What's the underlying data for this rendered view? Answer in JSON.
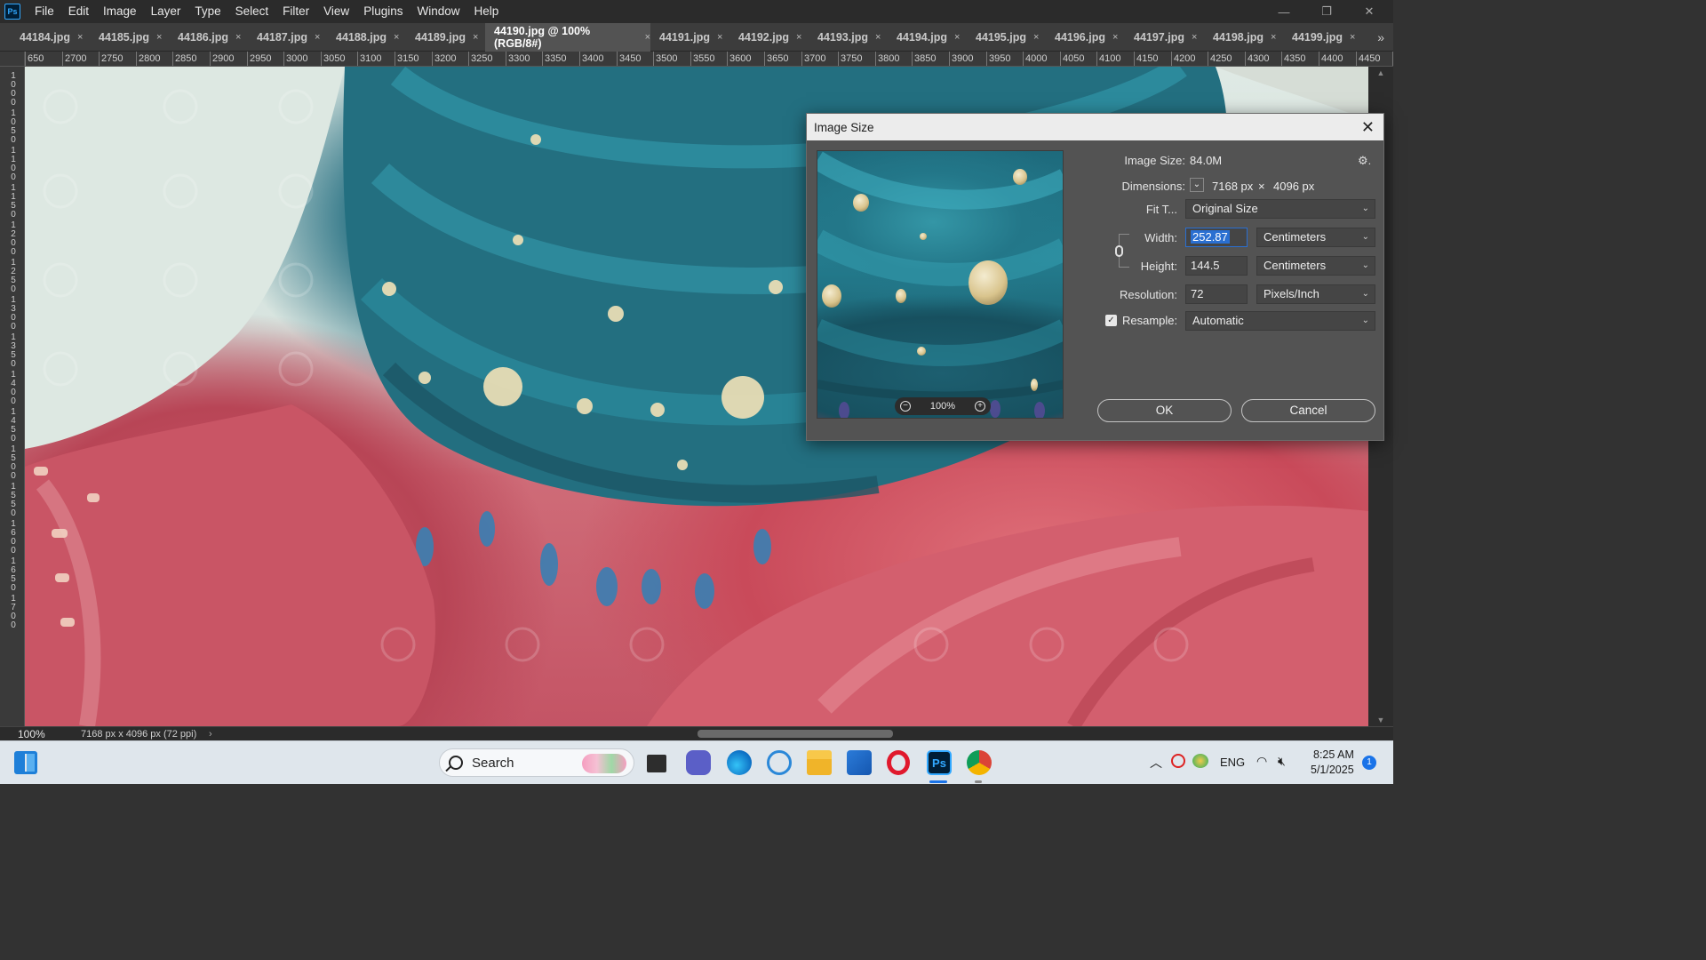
{
  "app": {
    "logo": "Ps"
  },
  "menu": [
    "File",
    "Edit",
    "Image",
    "Layer",
    "Type",
    "Select",
    "Filter",
    "View",
    "Plugins",
    "Window",
    "Help"
  ],
  "window_controls": {
    "minimize": "—",
    "restore": "❐",
    "close": "✕"
  },
  "tabs": [
    {
      "label": "44184.jpg",
      "active": false
    },
    {
      "label": "44185.jpg",
      "active": false
    },
    {
      "label": "44186.jpg",
      "active": false
    },
    {
      "label": "44187.jpg",
      "active": false
    },
    {
      "label": "44188.jpg",
      "active": false
    },
    {
      "label": "44189.jpg",
      "active": false
    },
    {
      "label": "44190.jpg @ 100% (RGB/8#)",
      "active": true
    },
    {
      "label": "44191.jpg",
      "active": false
    },
    {
      "label": "44192.jpg",
      "active": false
    },
    {
      "label": "44193.jpg",
      "active": false
    },
    {
      "label": "44194.jpg",
      "active": false
    },
    {
      "label": "44195.jpg",
      "active": false
    },
    {
      "label": "44196.jpg",
      "active": false
    },
    {
      "label": "44197.jpg",
      "active": false
    },
    {
      "label": "44198.jpg",
      "active": false
    },
    {
      "label": "44199.jpg",
      "active": false
    }
  ],
  "tab_close_glyph": "×",
  "tab_overflow_glyph": "»",
  "ruler_top_labels": [
    "650",
    "2700",
    "2750",
    "2800",
    "2850",
    "2900",
    "2950",
    "3000",
    "3050",
    "3100",
    "3150",
    "3200",
    "3250",
    "3300",
    "3350",
    "3400",
    "3450",
    "3500",
    "3550",
    "3600",
    "3650",
    "3700",
    "3750",
    "3800",
    "3850",
    "3900",
    "3950",
    "4000",
    "4050",
    "4100",
    "4150",
    "4200",
    "4250",
    "4300",
    "4350",
    "4400",
    "4450",
    "4"
  ],
  "ruler_left_labels": [
    "1000",
    "1050",
    "1100",
    "1150",
    "1200",
    "1250",
    "1300",
    "1350",
    "1400",
    "1450",
    "1500",
    "1550",
    "1600",
    "1650",
    "1700"
  ],
  "status": {
    "zoom": "100%",
    "doc_info": "7168 px x 4096 px (72 ppi)",
    "arrow": "›"
  },
  "dialog": {
    "title": "Image Size",
    "close_glyph": "✕",
    "gear_glyph": "⚙.",
    "image_size_label": "Image Size:",
    "image_size_value": "84.0M",
    "dimensions_label": "Dimensions:",
    "dimensions_width": "7168 px",
    "dimensions_x": "×",
    "dimensions_height": "4096 px",
    "fit_label": "Fit T...",
    "fit_value": "Original Size",
    "width_label": "Width:",
    "width_value": "252.87",
    "width_unit": "Centimeters",
    "height_label": "Height:",
    "height_value": "144.5",
    "height_unit": "Centimeters",
    "resolution_label": "Resolution:",
    "resolution_value": "72",
    "resolution_unit": "Pixels/Inch",
    "resample_label": "Resample:",
    "resample_checked": true,
    "resample_value": "Automatic",
    "preview_zoom": "100%",
    "ok_label": "OK",
    "cancel_label": "Cancel"
  },
  "taskbar": {
    "search_label": "Search",
    "language": "ENG",
    "time": "8:25 AM",
    "date": "5/1/2025",
    "notification_count": "1",
    "ps_label": "Ps"
  },
  "colors": {
    "ps_dark": "#2b2b2b",
    "dialog_bg": "#535353",
    "accent_blue": "#2a6fd1",
    "taskbar": "#dfe6ec"
  }
}
